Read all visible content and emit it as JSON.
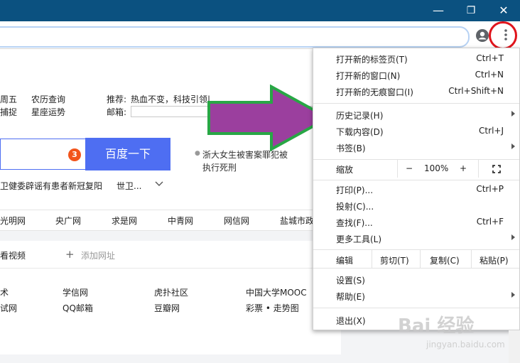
{
  "window": {
    "minimize": "—",
    "restore": "❐",
    "close": "✕"
  },
  "page": {
    "row1": [
      "周五",
      "农历查询"
    ],
    "row2": [
      "捕捉",
      "星座运势"
    ],
    "recommend_label": "推荐:",
    "recommend_text": "热血不变，科技引领|",
    "mailbox_label": "邮箱:",
    "badge": "3",
    "search_button": "百度一下",
    "news_1": "浙大女生被害案罪犯被",
    "news_2": "执行死刑",
    "hot_line": "卫健委辟谣有患者新冠复阳",
    "hot_line_2": "世卫...",
    "sites": [
      "光明网",
      "央广网",
      "求是网",
      "中青网",
      "网信网",
      "盐城市政"
    ],
    "watch_video": "看视频",
    "add_site": "添加网址",
    "links_row1": [
      "术",
      "学信网",
      "虎扑社区",
      "中国大学MOOC"
    ],
    "links_row2": [
      "试网",
      "QQ邮箱",
      "豆瓣网",
      "彩票 • 走势图"
    ]
  },
  "menu": {
    "new_tab": {
      "label": "打开新的标签页(T)",
      "shortcut": "Ctrl+T"
    },
    "new_window": {
      "label": "打开新的窗口(N)",
      "shortcut": "Ctrl+N"
    },
    "incognito": {
      "label": "打开新的无痕窗口(I)",
      "shortcut": "Ctrl+Shift+N"
    },
    "history": {
      "label": "历史记录(H)"
    },
    "downloads": {
      "label": "下载内容(D)",
      "shortcut": "Ctrl+J"
    },
    "bookmarks": {
      "label": "书签(B)"
    },
    "zoom": {
      "label": "缩放",
      "minus": "−",
      "value": "100%",
      "plus": "+"
    },
    "print": {
      "label": "打印(P)...",
      "shortcut": "Ctrl+P"
    },
    "cast": {
      "label": "投射(C)..."
    },
    "find": {
      "label": "查找(F)...",
      "shortcut": "Ctrl+F"
    },
    "more_tools": {
      "label": "更多工具(L)"
    },
    "edit": {
      "label": "编辑",
      "cut": "剪切(T)",
      "copy": "复制(C)",
      "paste": "粘贴(P)"
    },
    "settings": {
      "label": "设置(S)"
    },
    "help": {
      "label": "帮助(E)"
    },
    "exit": {
      "label": "退出(X)"
    }
  },
  "watermark": {
    "brand": "Bai 经验",
    "url": "jingyan.baidu.com"
  },
  "colors": {
    "titlebar": "#0b5180",
    "accent": "#4e6ef2",
    "arrow_fill": "#9b3f9e",
    "arrow_stroke": "#28a745",
    "highlight_circle": "#e0141c"
  }
}
